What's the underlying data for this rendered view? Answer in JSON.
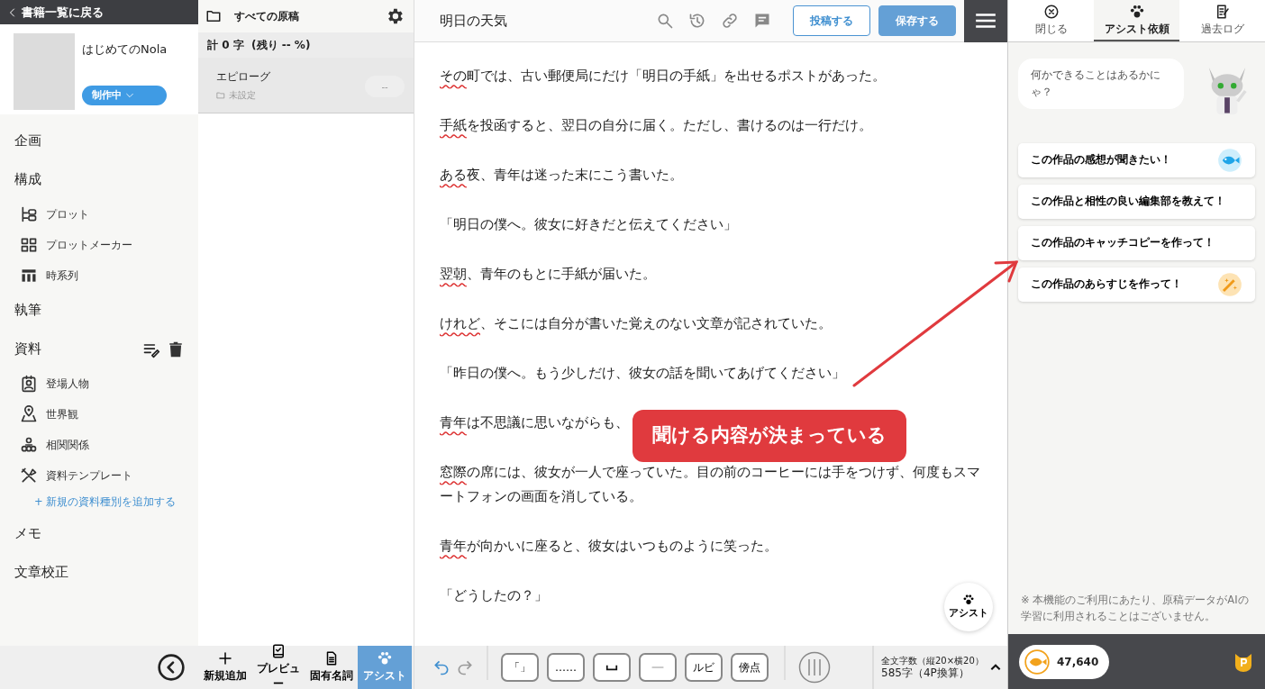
{
  "sidebar": {
    "back_link": "書籍一覧に戻る",
    "book": {
      "title": "はじめてのNola",
      "status": "制作中"
    },
    "nav": [
      {
        "kind": "section",
        "label": "企画"
      },
      {
        "kind": "section",
        "label": "構成"
      },
      {
        "kind": "item",
        "label": "プロット"
      },
      {
        "kind": "item",
        "label": "プロットメーカー"
      },
      {
        "kind": "item",
        "label": "時系列"
      },
      {
        "kind": "section",
        "label": "執筆"
      },
      {
        "kind": "section",
        "label": "資料",
        "tools": true
      },
      {
        "kind": "item",
        "label": "登場人物"
      },
      {
        "kind": "item",
        "label": "世界観"
      },
      {
        "kind": "item",
        "label": "相関関係"
      },
      {
        "kind": "item",
        "label": "資料テンプレート"
      },
      {
        "kind": "add",
        "label": "+ 新規の資料種別を追加する"
      },
      {
        "kind": "section",
        "label": "メモ"
      },
      {
        "kind": "section",
        "label": "文章校正"
      }
    ]
  },
  "file_list": {
    "title": "すべての原稿",
    "summary": "計 0 字  (残り -- %)",
    "files": [
      {
        "name": "エピローグ",
        "folder": "未設定",
        "badge": "--",
        "selected": true
      }
    ],
    "tools": [
      {
        "label": "新規追加",
        "selected": false
      },
      {
        "label": "プレビュー",
        "selected": false
      },
      {
        "label": "固有名詞",
        "selected": false
      },
      {
        "label": "アシスト",
        "selected": true
      }
    ]
  },
  "editor": {
    "title": "明日の天気",
    "buttons": [
      {
        "label": "投稿する",
        "kind": "outline"
      },
      {
        "label": "保存する",
        "kind": "solid"
      }
    ],
    "paragraphs": [
      {
        "marked": "その",
        "text": "町では、古い郵便局にだけ「明日の手紙」を出せるポストがあった。"
      },
      {
        "marked": "手紙",
        "text": "を投函すると、翌日の自分に届く。ただし、書けるのは一行だけ。"
      },
      {
        "marked": "ある",
        "text": "夜、青年は迷った末にこう書いた。"
      },
      {
        "text": "「明日の僕へ。彼女に好きだと伝えてください」"
      },
      {
        "marked": "翌朝",
        "text": "、青年のもとに手紙が届いた。"
      },
      {
        "marked": "けれど",
        "text": "、そこには自分が書いた覚えのない文章が記されていた。"
      },
      {
        "text": "「昨日の僕へ。もう少しだけ、彼女の話を聞いてあげてください」"
      },
      {
        "marked": "青年",
        "text": "は不思議に思いながらも、"
      },
      {
        "marked": "窓際",
        "text": "の席には、彼女が一人で座っていた。目の前のコーヒーには手をつけず、何度もスマートフォンの画面を消している。"
      },
      {
        "marked": "青年",
        "text": "が向かいに座ると、彼女はいつものように笑った。"
      },
      {
        "text": "「どうしたの？」"
      }
    ],
    "assist_fab": "アシスト",
    "format_buttons": [
      {
        "kind": "text",
        "label": "「」"
      },
      {
        "kind": "text",
        "label": "……"
      },
      {
        "kind": "space"
      },
      {
        "kind": "dash"
      },
      {
        "kind": "text",
        "label": "ルビ"
      },
      {
        "kind": "text",
        "label": "傍点"
      }
    ],
    "word_count": {
      "label": "全文字数（縦20×横20）",
      "value": "585字（4P換算）"
    }
  },
  "assist_panel": {
    "tabs": [
      {
        "label": "閉じる",
        "selected": false
      },
      {
        "label": "アシスト依頼",
        "selected": true
      },
      {
        "label": "過去ログ",
        "selected": false
      }
    ],
    "bubble": "何かできることはあるかにゃ？",
    "prompts": [
      {
        "label": "この作品の感想が聞きたい！",
        "kind": "fish"
      },
      {
        "label": "この作品と相性の良い編集部を教えて！",
        "kind": "plain"
      },
      {
        "label": "この作品のキャッチコピーを作って！",
        "kind": "plain"
      },
      {
        "label": "この作品のあらすじを作って！",
        "kind": "wand"
      }
    ],
    "notice": "※ 本機能のご利用にあたり、原稿データがAIの学習に利用されることはございません。",
    "coins": "47,640"
  },
  "annotation": {
    "callout": "聞ける内容が決まっている"
  }
}
